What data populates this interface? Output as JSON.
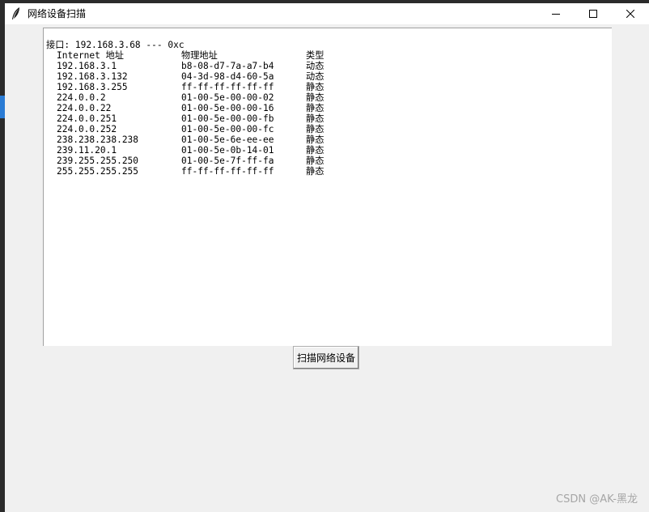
{
  "window": {
    "title": "网络设备扫描",
    "minimize_glyph": "—",
    "maximize_glyph": "☐",
    "close_glyph": "✕"
  },
  "output": {
    "interface_line": "接口: 192.168.3.68 --- 0xc",
    "headers": [
      "Internet 地址",
      "物理地址",
      "类型"
    ],
    "rows": [
      [
        "192.168.3.1",
        "b8-08-d7-7a-a7-b4",
        "动态"
      ],
      [
        "192.168.3.132",
        "04-3d-98-d4-60-5a",
        "动态"
      ],
      [
        "192.168.3.255",
        "ff-ff-ff-ff-ff-ff",
        "静态"
      ],
      [
        "224.0.0.2",
        "01-00-5e-00-00-02",
        "静态"
      ],
      [
        "224.0.0.22",
        "01-00-5e-00-00-16",
        "静态"
      ],
      [
        "224.0.0.251",
        "01-00-5e-00-00-fb",
        "静态"
      ],
      [
        "224.0.0.252",
        "01-00-5e-00-00-fc",
        "静态"
      ],
      [
        "238.238.238.238",
        "01-00-5e-6e-ee-ee",
        "静态"
      ],
      [
        "239.11.20.1",
        "01-00-5e-0b-14-01",
        "静态"
      ],
      [
        "239.255.255.250",
        "01-00-5e-7f-ff-fa",
        "静态"
      ],
      [
        "255.255.255.255",
        "ff-ff-ff-ff-ff-ff",
        "静态"
      ]
    ]
  },
  "scan_button": {
    "label": "扫描网络设备"
  },
  "watermark": {
    "text": "CSDN @AK-黑龙"
  },
  "icons": {
    "app": "feather-icon",
    "minimize": "minimize-icon",
    "maximize": "maximize-icon",
    "close": "close-icon"
  },
  "colors": {
    "window_bg": "#f0f0f0",
    "text_area_bg": "#ffffff",
    "titlebar_bg": "#ffffff",
    "watermark": "#a6a6a6"
  }
}
